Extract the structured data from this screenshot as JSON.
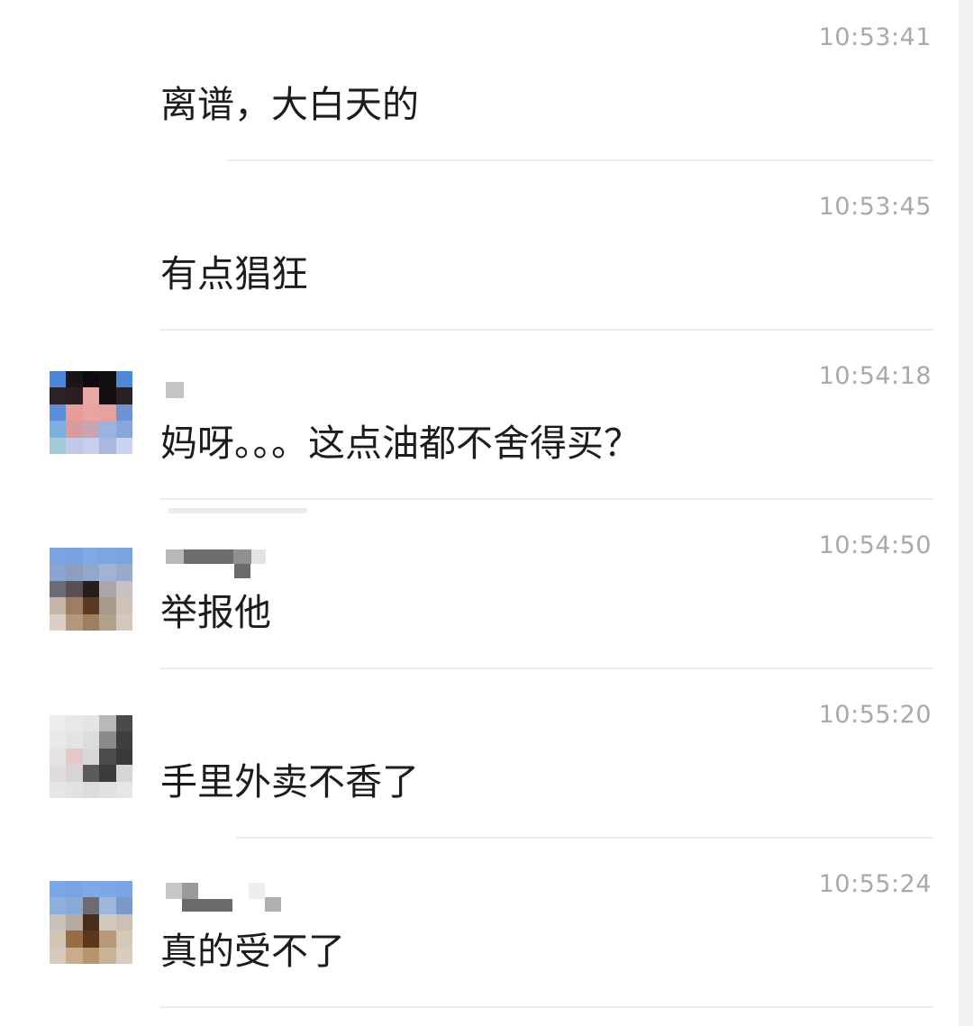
{
  "messages": [
    {
      "time": "10:53:41",
      "text": "离谱，大白天的",
      "avatar": null
    },
    {
      "time": "10:53:45",
      "text": "有点猖狂",
      "avatar": null
    },
    {
      "time": "10:54:18",
      "text": "妈呀。。。这点油都不舍得买？",
      "avatar": "pixelated-avatar-1"
    },
    {
      "time": "10:54:50",
      "text": "举报他",
      "avatar": "pixelated-avatar-2"
    },
    {
      "time": "10:55:20",
      "text": "手里外卖不香了",
      "avatar": "pixelated-avatar-3"
    },
    {
      "time": "10:55:24",
      "text": "真的受不了",
      "avatar": "pixelated-avatar-4"
    }
  ]
}
